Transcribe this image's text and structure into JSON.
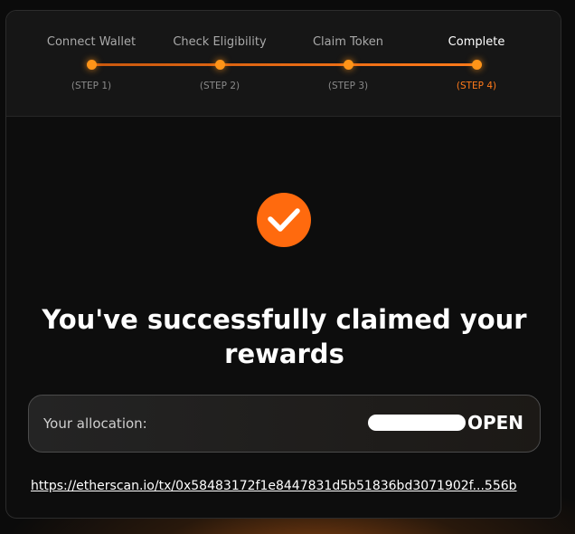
{
  "stepper": {
    "steps": [
      {
        "title": "Connect Wallet",
        "sub": "(STEP 1)",
        "active": false
      },
      {
        "title": "Check Eligibility",
        "sub": "(STEP 2)",
        "active": false
      },
      {
        "title": "Claim Token",
        "sub": "(STEP 3)",
        "active": false
      },
      {
        "title": "Complete",
        "sub": "(STEP 4)",
        "active": true
      }
    ]
  },
  "result": {
    "icon": "check-icon",
    "title": "You've successfully claimed your rewards"
  },
  "allocation": {
    "label": "Your allocation:",
    "value_suffix": "OPEN"
  },
  "transaction": {
    "link_text": "https://etherscan.io/tx/0x58483172f1e8447831d5b51836bd3071902f...556b"
  },
  "colors": {
    "accent": "#ff7a1a",
    "check_circle": "#ff6a0e",
    "background": "#0d0d0d"
  }
}
